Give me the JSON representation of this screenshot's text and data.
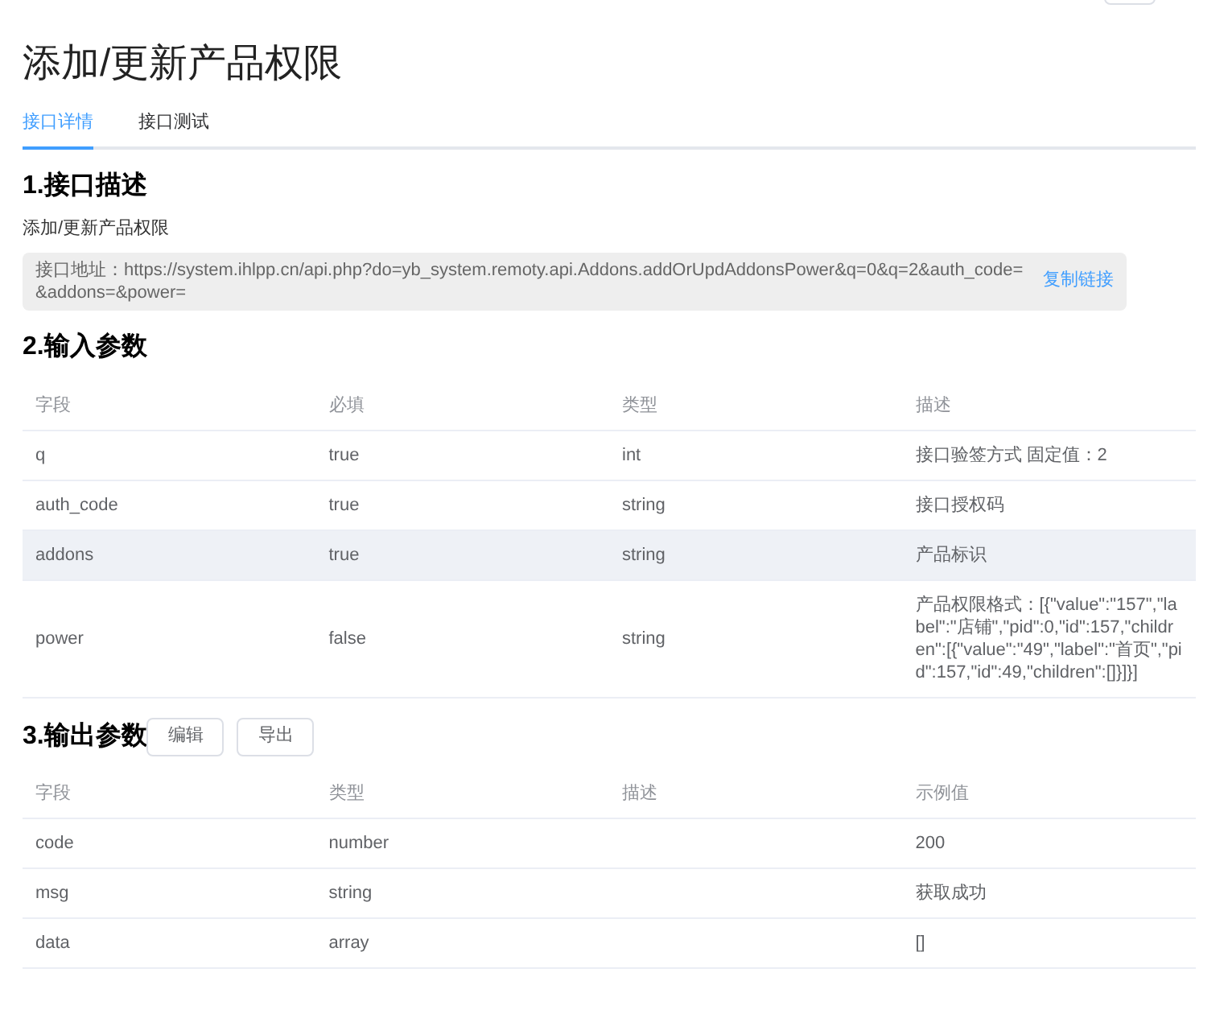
{
  "title": "添加/更新产品权限",
  "tabs": [
    {
      "label": "接口详情",
      "selected": true
    },
    {
      "label": "接口测试",
      "selected": false
    }
  ],
  "section_1": {
    "heading": "1.接口描述",
    "description": "添加/更新产品权限",
    "url_label": "接口地址：",
    "url": "https://system.ihlpp.cn/api.php?do=yb_system.remoty.api.Addons.addOrUpdAddonsPower&q=0&q=2&auth_code=&addons=&power=",
    "copy_link": "复制链接"
  },
  "section_2": {
    "heading": "2.输入参数",
    "columns": [
      "字段",
      "必填",
      "类型",
      "描述"
    ],
    "rows": [
      {
        "cells": [
          "q",
          "true",
          "int",
          "接口验签方式 固定值：2"
        ],
        "highlighted": false
      },
      {
        "cells": [
          "auth_code",
          "true",
          "string",
          "接口授权码"
        ],
        "highlighted": false
      },
      {
        "cells": [
          "addons",
          "true",
          "string",
          "产品标识"
        ],
        "highlighted": true
      },
      {
        "cells": [
          "power",
          "false",
          "string",
          "产品权限格式：[{\"value\":\"157\",\"label\":\"店铺\",\"pid\":0,\"id\":157,\"children\":[{\"value\":\"49\",\"label\":\"首页\",\"pid\":157,\"id\":49,\"children\":[]}]}]"
        ],
        "highlighted": false
      }
    ]
  },
  "section_3": {
    "heading": "3.输出参数",
    "buttons": [
      "编辑",
      "导出"
    ],
    "columns": [
      "字段",
      "类型",
      "描述",
      "示例值"
    ],
    "rows": [
      {
        "cells": [
          "code",
          "number",
          "",
          "200"
        ],
        "highlighted": false
      },
      {
        "cells": [
          "msg",
          "string",
          "",
          "获取成功"
        ],
        "highlighted": false
      },
      {
        "cells": [
          "data",
          "array",
          "",
          "[]"
        ],
        "highlighted": false
      }
    ]
  }
}
